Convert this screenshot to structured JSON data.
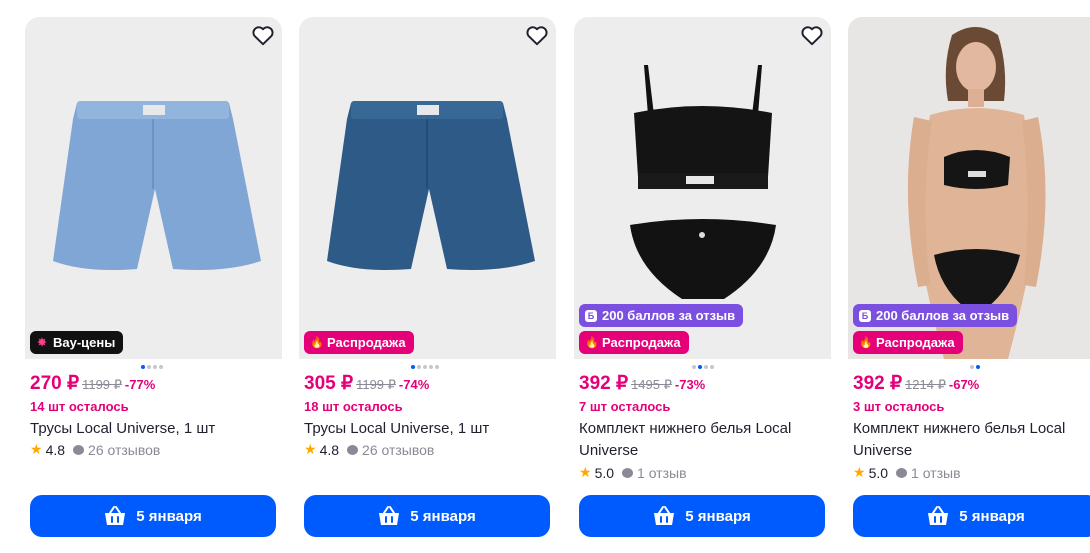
{
  "colors": {
    "accent": "#005bff",
    "price": "#e5007a",
    "badge_wow": "#111111",
    "badge_sale": "#e5007a",
    "badge_points": "#7b4fe0",
    "star": "#ffa800"
  },
  "cards": [
    {
      "price": "270 ₽",
      "old_price": "1199 ₽",
      "discount": "-77%",
      "stock": "14 шт осталось",
      "title": "Трусы Local Universe, 1 шт",
      "rating": "4.8",
      "reviews": "26 отзывов",
      "badges": [
        {
          "type": "wow",
          "label": "Вау-цены",
          "icon": "sparkle-icon"
        }
      ],
      "button": "5 января",
      "image": "light-blue-boxer-shorts"
    },
    {
      "price": "305 ₽",
      "old_price": "1199 ₽",
      "discount": "-74%",
      "stock": "18 шт осталось",
      "title": "Трусы Local Universe, 1 шт",
      "rating": "4.8",
      "reviews": "26 отзывов",
      "badges": [
        {
          "type": "sale",
          "label": "Распродажа",
          "icon": "flame-icon"
        }
      ],
      "button": "5 января",
      "image": "dark-blue-boxer-shorts"
    },
    {
      "price": "392 ₽",
      "old_price": "1495 ₽",
      "discount": "-73%",
      "stock": "7 шт осталось",
      "title": "Комплект нижнего белья Local Universe",
      "rating": "5.0",
      "reviews": "1 отзыв",
      "badges": [
        {
          "type": "points",
          "label": "200 баллов за отзыв",
          "icon": "points-icon"
        },
        {
          "type": "sale",
          "label": "Распродажа",
          "icon": "flame-icon"
        }
      ],
      "button": "5 января",
      "image": "black-lingerie-set"
    },
    {
      "price": "392 ₽",
      "old_price": "1214 ₽",
      "discount": "-67%",
      "stock": "3 шт осталось",
      "title": "Комплект нижнего белья Local Universe",
      "rating": "5.0",
      "reviews": "1 отзыв",
      "badges": [
        {
          "type": "points",
          "label": "200 баллов за отзыв",
          "icon": "points-icon"
        },
        {
          "type": "sale",
          "label": "Распродажа",
          "icon": "flame-icon"
        }
      ],
      "button": "5 января",
      "image": "model-in-black-lingerie"
    }
  ]
}
